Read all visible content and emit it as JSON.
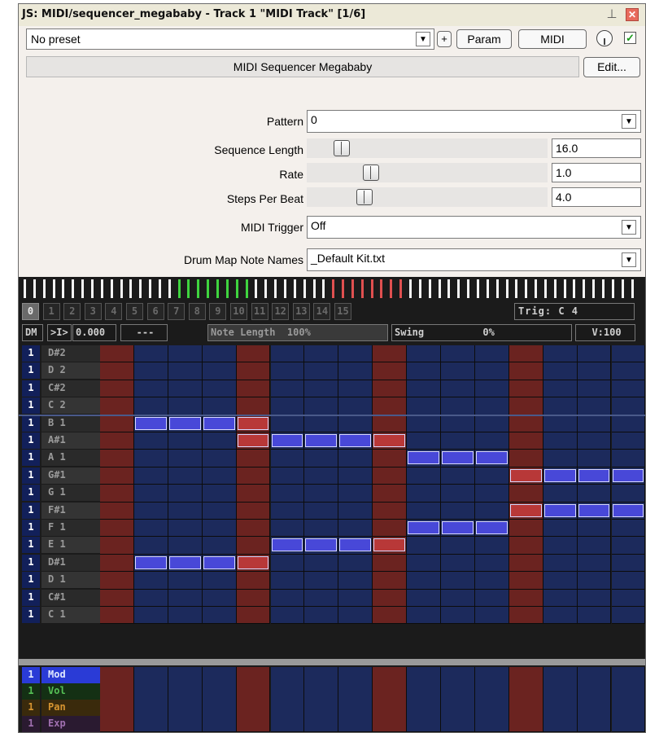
{
  "window": {
    "title": "JS: MIDI/sequencer_megababy - Track 1 \"MIDI Track\" [1/6]",
    "pin_glyph": "⊥",
    "close_glyph": "✕"
  },
  "toolbar": {
    "preset": "No preset",
    "add_label": "+",
    "param_label": "Param",
    "midi_label": "MIDI",
    "bypass_check": "✓",
    "dropdown_glyph": "▼"
  },
  "plugin": {
    "name": "MIDI Sequencer Megababy",
    "edit_label": "Edit..."
  },
  "params": [
    {
      "label": "Pattern",
      "type": "select",
      "value": "0"
    },
    {
      "label": "Sequence Length",
      "type": "slider",
      "value": "16.0",
      "level": 0.12
    },
    {
      "label": "Rate",
      "type": "slider",
      "value": "1.0",
      "level": 0.25
    },
    {
      "label": "Steps Per Beat",
      "type": "slider",
      "value": "4.0",
      "level": 0.22
    },
    {
      "label": "MIDI Trigger",
      "type": "select",
      "value": "Off"
    },
    {
      "label": "Drum Map Note Names",
      "type": "select",
      "value": "_Default Kit.txt"
    }
  ],
  "sequencer": {
    "step_ticks": {
      "count": 64,
      "green_range": [
        16,
        23
      ],
      "red_range": [
        32,
        39
      ]
    },
    "steps": [
      "0",
      "1",
      "2",
      "3",
      "4",
      "5",
      "6",
      "7",
      "8",
      "9",
      "10",
      "11",
      "12",
      "13",
      "14",
      "15"
    ],
    "current_step": 0,
    "trigger_label": "Trig: C 4",
    "controls": {
      "dm": "DM",
      "play": ">I>",
      "position": "0.000",
      "dashes": "---",
      "note_length": "Note Length  100%",
      "swing": "Swing          0%",
      "velocity": "V:100"
    },
    "note_rows": [
      {
        "ch": "1",
        "note": "D#2"
      },
      {
        "ch": "1",
        "note": "D 2"
      },
      {
        "ch": "1",
        "note": "C#2"
      },
      {
        "ch": "1",
        "note": "C 2"
      },
      {
        "ch": "1",
        "note": "B 1"
      },
      {
        "ch": "1",
        "note": "A#1"
      },
      {
        "ch": "1",
        "note": "A 1"
      },
      {
        "ch": "1",
        "note": "G#1"
      },
      {
        "ch": "1",
        "note": "G 1"
      },
      {
        "ch": "1",
        "note": "F#1"
      },
      {
        "ch": "1",
        "note": "F 1"
      },
      {
        "ch": "1",
        "note": "E 1"
      },
      {
        "ch": "1",
        "note": "D#1"
      },
      {
        "ch": "1",
        "note": "D 1"
      },
      {
        "ch": "1",
        "note": "C#1"
      },
      {
        "ch": "1",
        "note": "C 1"
      }
    ],
    "notes": [
      {
        "row": 4,
        "steps": [
          1,
          2,
          3,
          4
        ]
      },
      {
        "row": 5,
        "steps": [
          4,
          5,
          6,
          7,
          8
        ]
      },
      {
        "row": 6,
        "steps": [
          9,
          10,
          11
        ]
      },
      {
        "row": 7,
        "steps": [
          12,
          13,
          14,
          15
        ]
      },
      {
        "row": 9,
        "steps": [
          12,
          13,
          14,
          15
        ]
      },
      {
        "row": 10,
        "steps": [
          9,
          10,
          11
        ]
      },
      {
        "row": 11,
        "steps": [
          5,
          6,
          7,
          8
        ]
      },
      {
        "row": 12,
        "steps": [
          1,
          2,
          3,
          4
        ]
      }
    ],
    "cc_rows": [
      {
        "ch": "1",
        "name": "Mod",
        "color": "#2a3bd6",
        "text_color": "#e0e8ff"
      },
      {
        "ch": "1",
        "name": "Vol",
        "color": "#143014",
        "text_color": "#55c055"
      },
      {
        "ch": "1",
        "name": "Pan",
        "color": "#3a2a0c",
        "text_color": "#d79430"
      },
      {
        "ch": "1",
        "name": "Exp",
        "color": "#2a1a30",
        "text_color": "#a070b0"
      }
    ],
    "colors": {
      "grid_blue": "#1c2a5c",
      "beat_red": "#6b2320",
      "note_blue": "#4848d8",
      "note_red": "#b83838"
    }
  }
}
